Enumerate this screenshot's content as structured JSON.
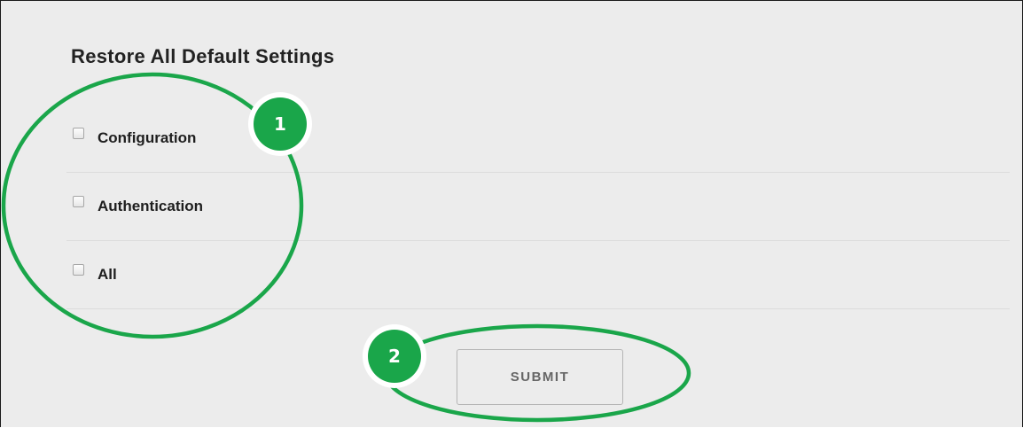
{
  "section": {
    "title": "Restore All Default Settings"
  },
  "options": [
    {
      "label": "Configuration",
      "checked": false
    },
    {
      "label": "Authentication",
      "checked": false
    },
    {
      "label": "All",
      "checked": false
    }
  ],
  "submit": {
    "label": "SUBMIT"
  },
  "annotations": {
    "color": "#1aa64a",
    "markers": [
      {
        "number": "1"
      },
      {
        "number": "2"
      }
    ]
  }
}
